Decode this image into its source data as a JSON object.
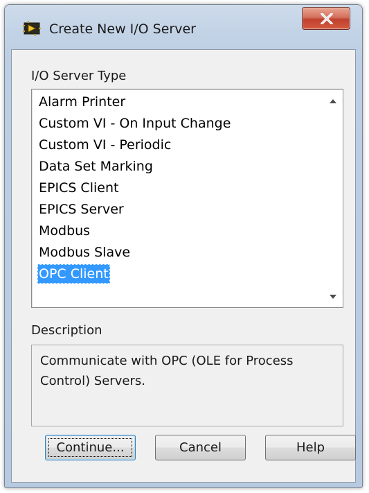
{
  "window": {
    "title": "Create New I/O Server",
    "icon": "labview-vi-icon",
    "close_icon": "close-x-icon"
  },
  "server_type": {
    "label": "I/O Server Type",
    "items": [
      "Alarm Printer",
      "Custom VI - On Input Change",
      "Custom VI - Periodic",
      "Data Set Marking",
      "EPICS Client",
      "EPICS Server",
      "Modbus",
      "Modbus Slave",
      "OPC Client"
    ],
    "selected": "OPC Client"
  },
  "description": {
    "label": "Description",
    "text": "Communicate with OPC (OLE for Process Control) Servers."
  },
  "buttons": {
    "continue": "Continue...",
    "cancel": "Cancel",
    "help": "Help"
  },
  "colors": {
    "selection": "#3399ff",
    "close_button": "#c7452f",
    "title_bar": "#c3d3e6"
  }
}
